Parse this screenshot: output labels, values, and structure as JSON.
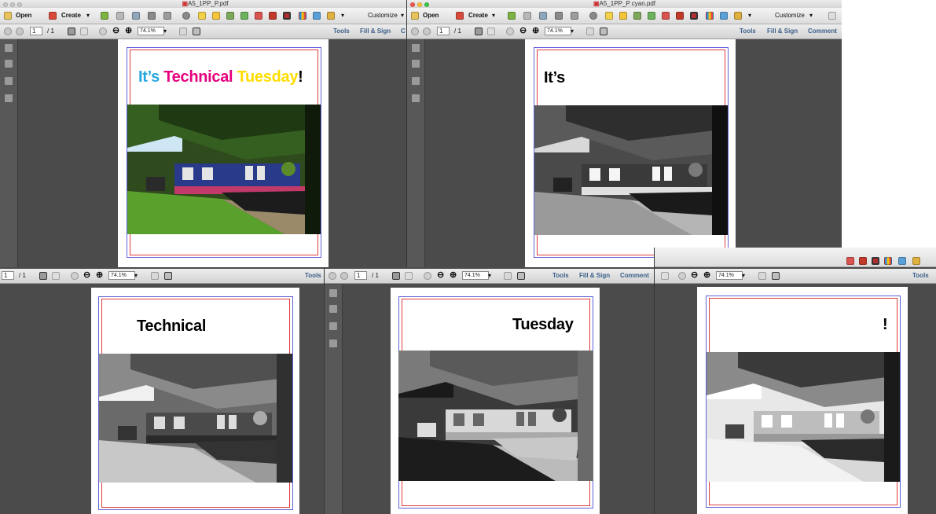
{
  "windows": {
    "w1": {
      "file": "A5_1PP_P.pdf",
      "open": "Open",
      "create": "Create",
      "customize": "Customize",
      "page_num": "1",
      "page_total": "/ 1",
      "zoom": "74.1%",
      "tools": "Tools",
      "fill_sign": "Fill & Sign",
      "comment_partial": "C"
    },
    "w2": {
      "file": "A5_1PP_P cyan.pdf",
      "open": "Open",
      "create": "Create",
      "customize": "Customize",
      "page_num": "1",
      "page_total": "/ 1",
      "zoom": "74.1%",
      "tools": "Tools",
      "fill_sign": "Fill & Sign",
      "comment": "Comment"
    },
    "w3": {
      "page_num": "1",
      "page_total": "/ 1",
      "zoom": "74.1%",
      "tools": "Tools"
    },
    "w4": {
      "page_num": "1",
      "page_total": "/ 1",
      "zoom": "74.1%",
      "tools": "Tools",
      "fill_sign": "Fill & Sign",
      "comment": "Comment"
    },
    "w5": {
      "zoom": "74.1%",
      "tools": "Tools"
    }
  },
  "headings": {
    "composite": {
      "its": "It’s",
      "technical": "Technical",
      "tuesday": "Tuesday",
      "bang": "!"
    },
    "cyan": "It’s",
    "magenta": "Technical",
    "yellow": "Tuesday",
    "black": "!"
  },
  "colors": {
    "cyan": "#27a8e0",
    "magenta": "#e6007e",
    "yellow": "#ffdd00",
    "black": "#000000",
    "trim_red": "#e03c3c",
    "bleed_blue": "#6060d8",
    "workspace": "#4b4b4b",
    "link_blue": "#3b5f8a"
  },
  "icons": [
    "folder-icon",
    "create-pdf-icon",
    "save-icon",
    "cloud-icon",
    "print-icon",
    "edit-icon",
    "gear-icon",
    "comment-icon",
    "highlight-icon",
    "stamp-icon",
    "export-icon",
    "output-preview-icon",
    "bar-chart-icon",
    "measure-icon",
    "select-arrow-icon",
    "hand-icon",
    "zoom-out-icon",
    "zoom-in-icon",
    "fit-page-icon",
    "fullscreen-icon"
  ]
}
